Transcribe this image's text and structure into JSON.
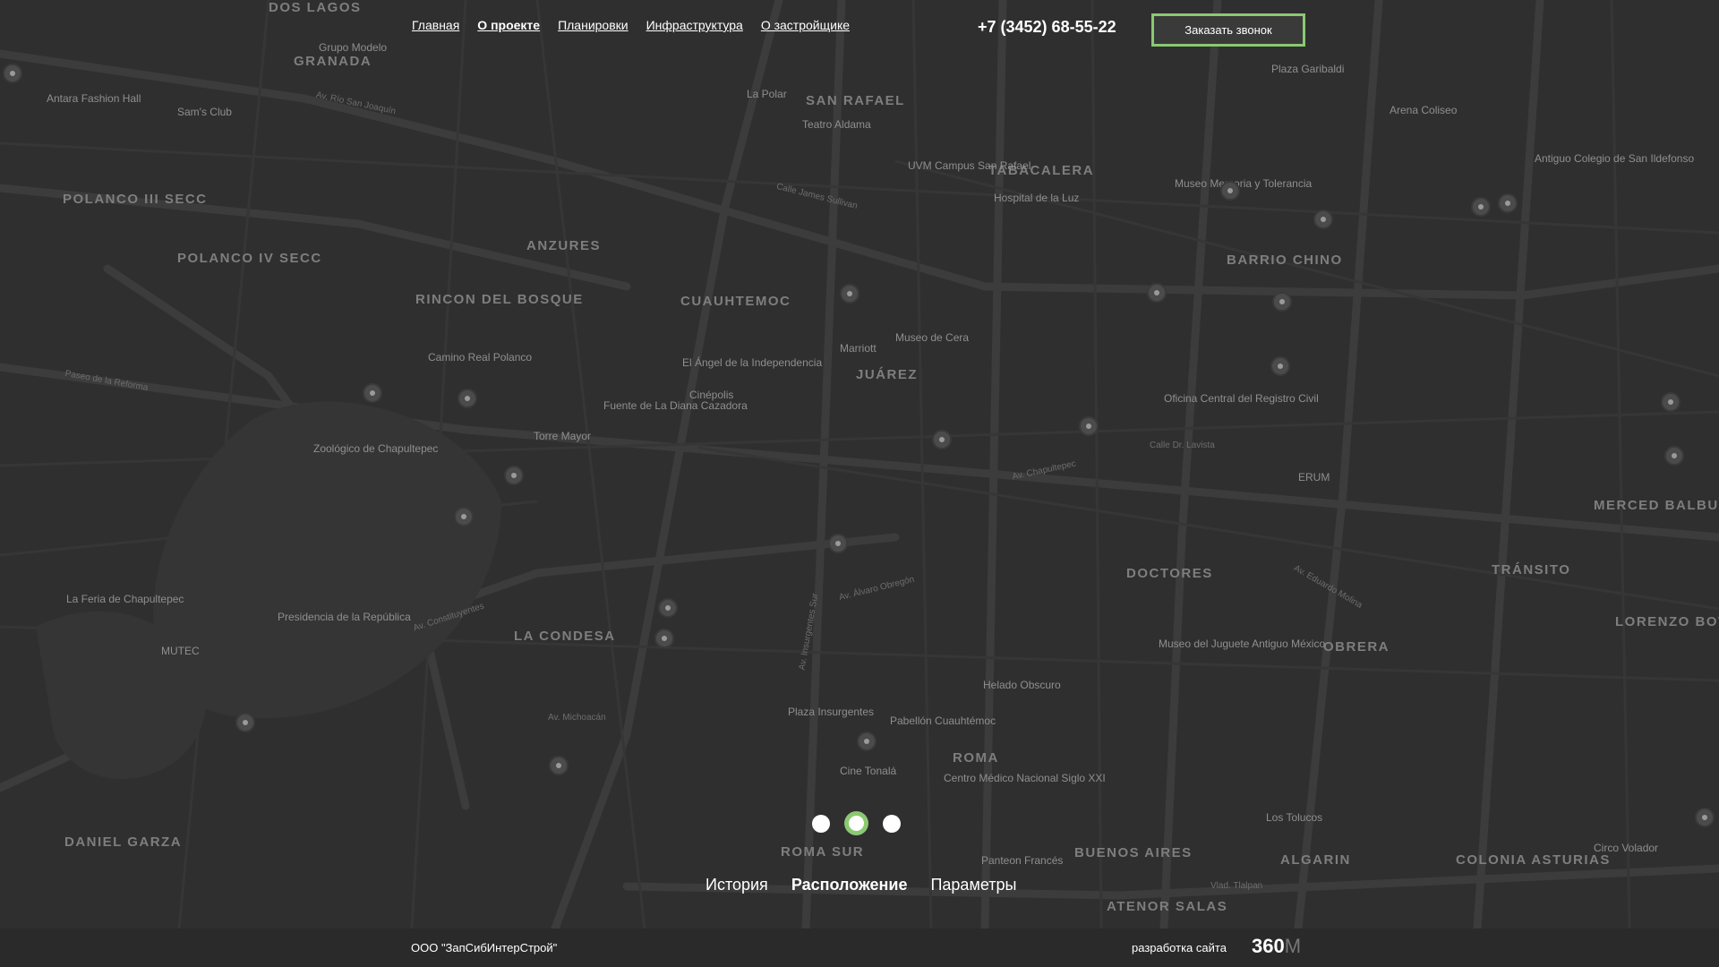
{
  "nav": {
    "items": [
      "Главная",
      "О проекте",
      "Планировки",
      "Инфраструктура",
      "О застройщике"
    ],
    "active_index": 1
  },
  "header": {
    "phone": "+7 (3452) 68-55-22",
    "call_button": "Заказать звонок"
  },
  "slider": {
    "dot_count": 3,
    "active_index": 1
  },
  "tabs": {
    "items": [
      "История",
      "Расположение",
      "Параметры"
    ],
    "active_index": 1
  },
  "footer": {
    "company": "ООО \"ЗапСибИнтерСтрой\"",
    "dev_label": "разработка сайта",
    "logo_main": "360",
    "logo_suffix": "M"
  },
  "map": {
    "districts": [
      "GRANADA",
      "ANZURES",
      "RINCON DEL BOSQUE",
      "CUAUHTEMOC",
      "JUÁREZ",
      "SAN RAFAEL",
      "TABACALERA",
      "BARRIO CHINO",
      "POLANCO III SECC",
      "POLANCO IV SECC",
      "LA CONDESA",
      "ROMA SUR",
      "ROMA",
      "DOCTORES",
      "OBRERA",
      "ALGARIN",
      "BUENOS AIRES",
      "MERCED BALBUENA",
      "TRÁNSITO",
      "LORENZO BOTURINI",
      "DANIEL GARZA",
      "COLONIA ASTURIAS",
      "ATENOR SALAS",
      "DOS LAGOS"
    ],
    "pois": [
      "Antara Fashion Hall",
      "Sam's Club",
      "Grupo Modelo",
      "Camino Real Polanco",
      "Zoológico de Chapultepec",
      "La Feria de Chapultepec",
      "Presidencia de la República",
      "MUTEC",
      "El Ángel de la Independencia",
      "Cinépolis",
      "Fuente de La Diana Cazadora",
      "Torre Mayor",
      "Marriott",
      "Museo de Cera",
      "Hospital de la Luz",
      "UVM Campus San Rafael",
      "Teatro Aldama",
      "La Polar",
      "Museo Memoria y Tolerancia",
      "Plaza Garibaldi",
      "Arena Coliseo",
      "Antiguo Colegio de San Ildefonso",
      "Oficina Central del Registro Civil",
      "ERUM",
      "Museo del Juguete Antiguo México",
      "Helado Obscuro",
      "Pabellón Cuauhtémoc",
      "Plaza Insurgentes",
      "Cine Tonalá",
      "Centro Médico Nacional Siglo XXI",
      "Los Tolucos",
      "Circo Volador",
      "Panteon Francés"
    ],
    "streets": [
      "Av. Río San Joaquín",
      "Paseo de la Reforma",
      "Av. Constituyentes",
      "Av. Insurgentes Sur",
      "Av. Álvaro Obregón",
      "Av. Chapultepec",
      "Calle Dr. Lavista",
      "Vlad. Tlalpan",
      "Av. Michoacán",
      "Calle James Sullivan",
      "Av. Eduardo Molina"
    ]
  }
}
